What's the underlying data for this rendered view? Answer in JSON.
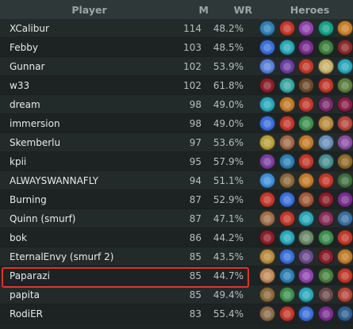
{
  "headers": {
    "player": "Player",
    "matches": "M",
    "winrate": "WR",
    "heroes": "Heroes"
  },
  "rows": [
    {
      "player": "XCalibur",
      "m": "114",
      "wr": "48.2%",
      "heroes": [
        "#2f7fb3",
        "#c0392b",
        "#8e44ad",
        "#16a085",
        "#c87f2a"
      ]
    },
    {
      "player": "Febby",
      "m": "103",
      "wr": "48.5%",
      "heroes": [
        "#3b6fd8",
        "#2aa7b8",
        "#7b2f8f",
        "#3f7f3f",
        "#8a2b2b"
      ]
    },
    {
      "player": "Gunnar",
      "m": "102",
      "wr": "53.9%",
      "heroes": [
        "#5a7fd8",
        "#6a3fa0",
        "#c0392b",
        "#c8b26a",
        "#2aa7b8"
      ]
    },
    {
      "player": "w33",
      "m": "102",
      "wr": "61.8%",
      "heroes": [
        "#8a1f2a",
        "#3aa7a0",
        "#6a4a2a",
        "#c0392b",
        "#5a7f3f"
      ]
    },
    {
      "player": "dream",
      "m": "98",
      "wr": "49.0%",
      "heroes": [
        "#2aa7b8",
        "#c07a2a",
        "#c0392b",
        "#7a2a6a",
        "#8a1f4a"
      ]
    },
    {
      "player": "immersion",
      "m": "98",
      "wr": "49.0%",
      "heroes": [
        "#3b6fd8",
        "#c0392b",
        "#3f8f4f",
        "#b88a3f",
        "#b5453a"
      ]
    },
    {
      "player": "Skemberlu",
      "m": "97",
      "wr": "53.6%",
      "heroes": [
        "#b8a03a",
        "#a06a4a",
        "#c07a2a",
        "#6a8fb8",
        "#8a4fa0"
      ]
    },
    {
      "player": "kpii",
      "m": "95",
      "wr": "57.9%",
      "heroes": [
        "#7a3f9f",
        "#2f7fb3",
        "#c0392b",
        "#4a8f8f",
        "#8f6a2a"
      ]
    },
    {
      "player": "ALWAYSWANNAFLY",
      "m": "94",
      "wr": "51.1%",
      "heroes": [
        "#3f8fd8",
        "#8a6a3a",
        "#c07a2a",
        "#c0392b",
        "#3f6f3f"
      ]
    },
    {
      "player": "Burning",
      "m": "87",
      "wr": "52.9%",
      "heroes": [
        "#c0392b",
        "#3b6fd8",
        "#a05a3a",
        "#8a1f2a",
        "#7a2f8f"
      ]
    },
    {
      "player": "Quinn (smurf)",
      "m": "87",
      "wr": "47.1%",
      "heroes": [
        "#a0704a",
        "#c0392b",
        "#2aa7b8",
        "#8a2f5a",
        "#3a6fa0"
      ]
    },
    {
      "player": "bok",
      "m": "86",
      "wr": "44.2%",
      "heroes": [
        "#8a1f2a",
        "#2aa7b8",
        "#6a8a6a",
        "#3f8f4f",
        "#c0392b"
      ]
    },
    {
      "player": "EternalEnvy (smurf 2)",
      "m": "85",
      "wr": "43.5%",
      "heroes": [
        "#b88a3f",
        "#3b6fd8",
        "#6a4a8a",
        "#8a1f2a",
        "#c07a2a"
      ]
    },
    {
      "player": "Paparazi",
      "m": "85",
      "wr": "44.7%",
      "heroes": [
        "#c08a5a",
        "#2f7fb3",
        "#8e44ad",
        "#4a7f3f",
        "#c0392b"
      ]
    },
    {
      "player": "papita",
      "m": "85",
      "wr": "49.4%",
      "heroes": [
        "#8a6a3a",
        "#3f8f4f",
        "#2aa7b8",
        "#6a4a4a",
        "#b5453a"
      ]
    },
    {
      "player": "RodiER",
      "m": "83",
      "wr": "55.4%",
      "heroes": [
        "#8a6a4a",
        "#c0392b",
        "#3b6fd8",
        "#7a2f8f",
        "#2f5f8f"
      ]
    }
  ],
  "highlight_color": "#e0322a"
}
